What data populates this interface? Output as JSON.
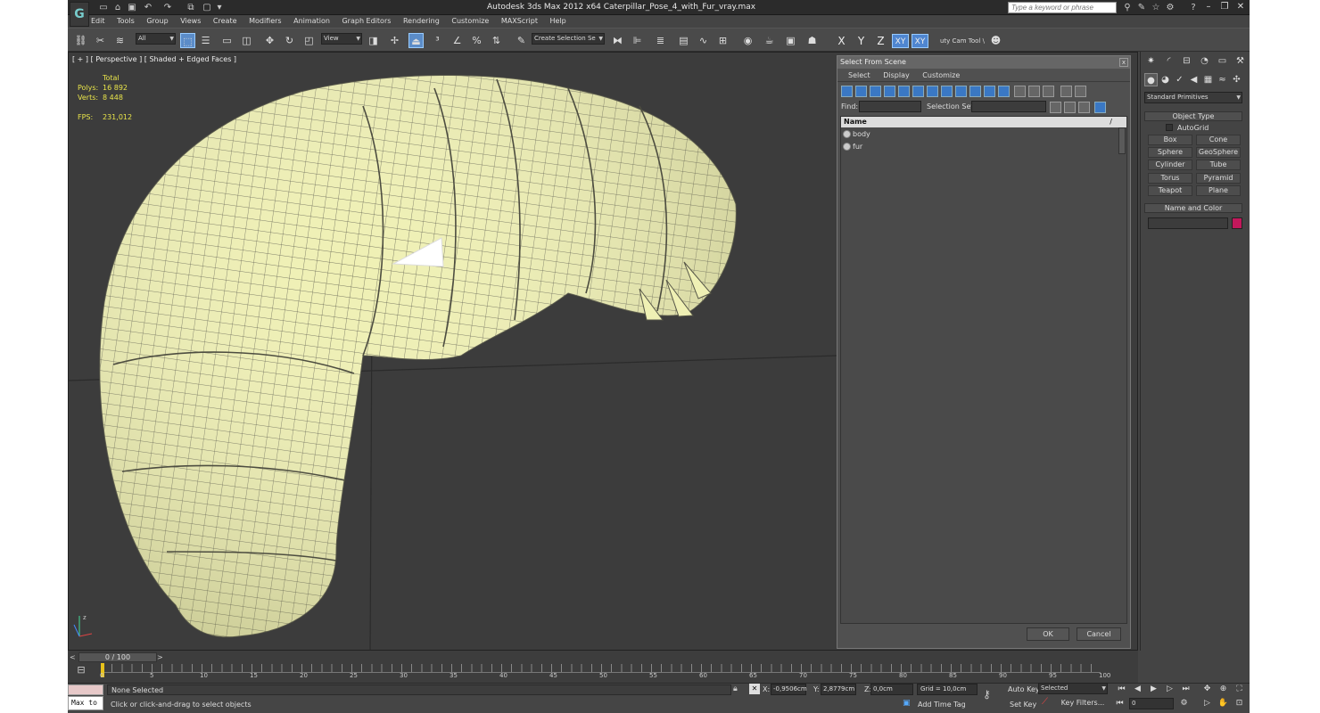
{
  "window": {
    "title": "Autodesk 3ds Max  2012 x64      Caterpillar_Pose_4_with_Fur_vray.max",
    "help_placeholder": "Type a keyword or phrase"
  },
  "menu": [
    "Edit",
    "Tools",
    "Group",
    "Views",
    "Create",
    "Modifiers",
    "Animation",
    "Graph Editors",
    "Rendering",
    "Customize",
    "MAXScript",
    "Help"
  ],
  "toolbar": {
    "filter_value": "All",
    "refcoord_value": "View",
    "selection_set_placeholder": "Create Selection Se",
    "axes": [
      "X",
      "Y",
      "Z",
      "XY",
      "XY"
    ],
    "extra_label": "uty Cam Tool \\"
  },
  "viewport": {
    "label": "[ + ] [ Perspective ] [ Shaded + Edged Faces ]",
    "stats": {
      "total_label": "Total",
      "polys_label": "Polys:",
      "polys_value": "16 892",
      "verts_label": "Verts:",
      "verts_value": "8 448",
      "fps_label": "FPS:",
      "fps_value": "231,012"
    },
    "axis_labels": [
      "z",
      "x",
      "y"
    ]
  },
  "select_dialog": {
    "title": "Select From Scene",
    "close": "x",
    "menu": [
      "Select",
      "Display",
      "Customize"
    ],
    "find_label": "Find:",
    "selection_set_label": "Selection Set:",
    "column_name": "Name",
    "column_sort": "/",
    "rows": [
      "body",
      "fur"
    ],
    "ok_label": "OK",
    "cancel_label": "Cancel"
  },
  "command_panel": {
    "dropdown_value": "Standard Primitives",
    "object_type_title": "Object Type",
    "autogrid_label": "AutoGrid",
    "primitives": [
      "Box",
      "Cone",
      "Sphere",
      "GeoSphere",
      "Cylinder",
      "Tube",
      "Torus",
      "Pyramid",
      "Teapot",
      "Plane"
    ],
    "name_color_title": "Name and Color",
    "color_swatch": "#c2185b"
  },
  "timeline": {
    "frame_label": "0 / 100",
    "prev": "<",
    "next": ">",
    "ticks": [
      "0",
      "5",
      "10",
      "15",
      "20",
      "25",
      "30",
      "35",
      "40",
      "45",
      "50",
      "55",
      "60",
      "65",
      "70",
      "75",
      "80",
      "85",
      "90",
      "95",
      "100"
    ]
  },
  "status": {
    "maxscript_label": "Max to",
    "selection_text": "None Selected",
    "prompt_text": "Click or click-and-drag to select objects",
    "x_label": "X:",
    "x_value": "-0,9506cm",
    "y_label": "Y:",
    "y_value": "2,8779cm",
    "z_label": "Z:",
    "z_value": "0,0cm",
    "grid_text": "Grid = 10,0cm",
    "add_time_tag": "Add Time Tag",
    "auto_key": "Auto Key",
    "set_key": "Set Key",
    "selected_value": "Selected",
    "key_filters": "Key Filters...",
    "frame_value": "0"
  }
}
